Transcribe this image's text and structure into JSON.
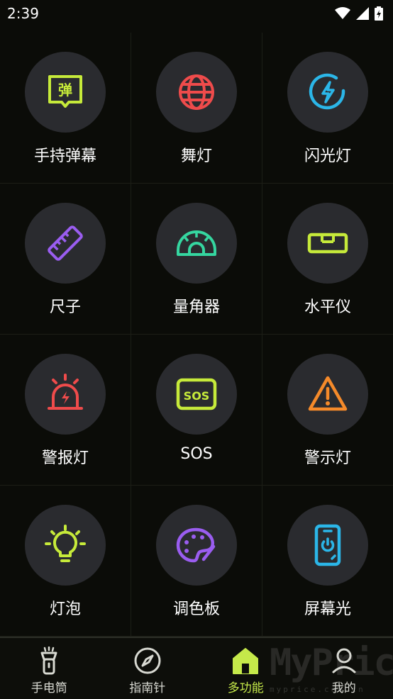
{
  "status": {
    "time": "2:39"
  },
  "features": [
    {
      "label": "手持弹幕",
      "icon": "danmaku-icon",
      "color": "#c6ea3a",
      "glyph": "弹"
    },
    {
      "label": "舞灯",
      "icon": "disco-ball-icon",
      "color": "#ef4b4b"
    },
    {
      "label": "闪光灯",
      "icon": "flash-icon",
      "color": "#2bb6e8"
    },
    {
      "label": "尺子",
      "icon": "ruler-icon",
      "color": "#9a5df0"
    },
    {
      "label": "量角器",
      "icon": "protractor-icon",
      "color": "#35d6a0"
    },
    {
      "label": "水平仪",
      "icon": "spirit-level-icon",
      "color": "#c6ea3a"
    },
    {
      "label": "警报灯",
      "icon": "alarm-light-icon",
      "color": "#ef4b4b"
    },
    {
      "label": "SOS",
      "icon": "sos-icon",
      "color": "#c6ea3a",
      "glyph": "SOS"
    },
    {
      "label": "警示灯",
      "icon": "warning-icon",
      "color": "#f58a2a"
    },
    {
      "label": "灯泡",
      "icon": "lightbulb-icon",
      "color": "#c6ea3a"
    },
    {
      "label": "调色板",
      "icon": "palette-icon",
      "color": "#9a5df0"
    },
    {
      "label": "屏幕光",
      "icon": "screen-light-icon",
      "color": "#2bb6e8"
    }
  ],
  "tabs": [
    {
      "label": "手电筒",
      "icon": "flashlight-icon"
    },
    {
      "label": "指南针",
      "icon": "compass-icon"
    },
    {
      "label": "多功能",
      "icon": "home-icon",
      "active": true
    },
    {
      "label": "我的",
      "icon": "profile-icon"
    }
  ],
  "watermark": {
    "text": "MyPrice",
    "sub": "myprice.com.cn"
  }
}
